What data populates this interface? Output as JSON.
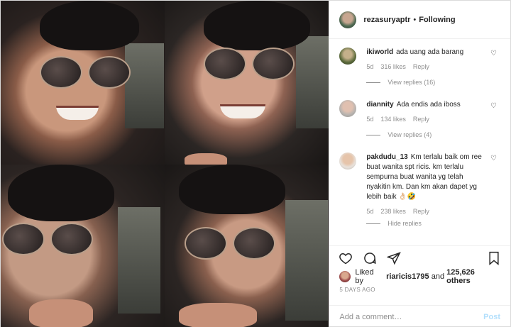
{
  "header": {
    "username": "rezasuryaptr",
    "separator": "•",
    "following_label": "Following"
  },
  "comments": [
    {
      "username": "ikiworld",
      "text": "ada uang ada barang",
      "age": "5d",
      "likes": "316 likes",
      "reply": "Reply",
      "replies_label": "View replies (16)"
    },
    {
      "username": "diannity",
      "text": "Ada endis ada iboss",
      "age": "5d",
      "likes": "134 likes",
      "reply": "Reply",
      "replies_label": "View replies (4)"
    },
    {
      "username": "pakdudu_13",
      "text": "Km terlalu baik om ree buat wanita spt ricis. km terlalu sempurna buat wanita yg telah nyakitin km. Dan km akan dapet yg lebih baik 👌🏻🤣",
      "age": "5d",
      "likes": "238 likes",
      "reply": "Reply",
      "replies_label": "Hide replies"
    }
  ],
  "icons": [
    "heart-icon",
    "comment-icon",
    "share-icon",
    "bookmark-icon"
  ],
  "likes": {
    "prefix": "Liked by",
    "user": "riaricis1795",
    "conj": "and",
    "count": "125,626 others"
  },
  "date": "5 DAYS AGO",
  "add_comment": {
    "placeholder": "Add a comment…",
    "post_label": "Post"
  },
  "colors": {
    "post_button": "#b2dffc",
    "meta": "#8e8e8e",
    "text": "#262626"
  }
}
